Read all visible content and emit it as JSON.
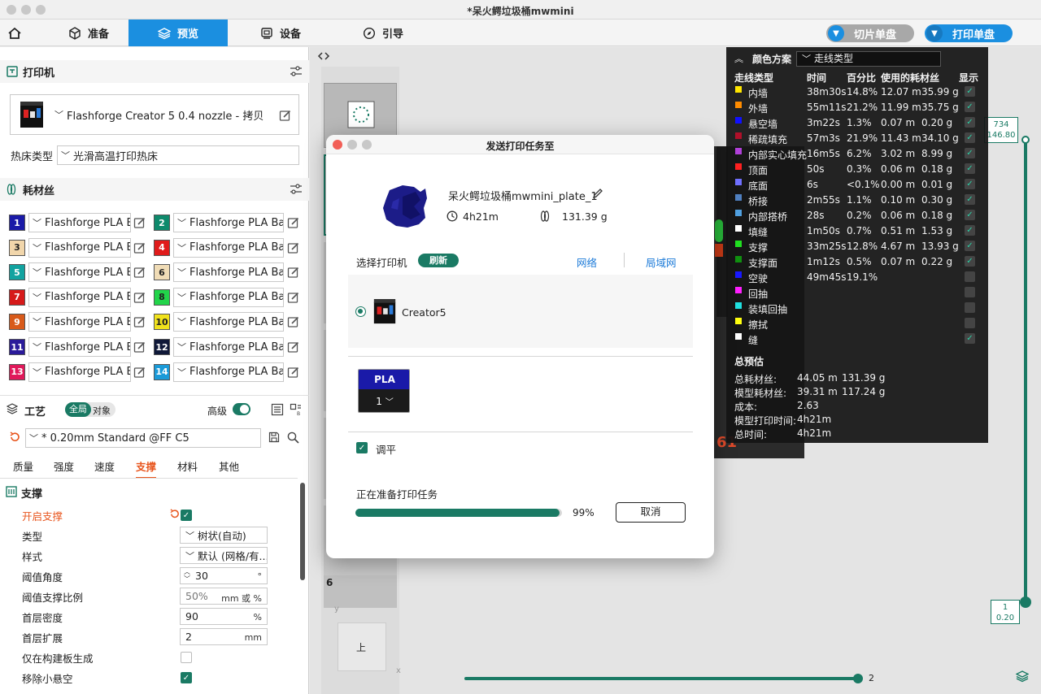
{
  "window": {
    "title": "*呆火鳄垃圾桶mwmini"
  },
  "toolbar": {
    "tabs": [
      {
        "label": "准备"
      },
      {
        "label": "预览"
      },
      {
        "label": "设备"
      },
      {
        "label": "引导"
      }
    ],
    "slice_button": "切片单盘",
    "print_button": "打印单盘"
  },
  "printer_section": {
    "title": "打印机",
    "printer_name": "Flashforge Creator 5 0.4 nozzle - 拷贝",
    "bed_label": "热床类型",
    "bed_value": "光滑高温打印热床"
  },
  "filament_section": {
    "title": "耗材丝",
    "items": [
      {
        "num": "1",
        "color": "#1a1aa8",
        "name": "Flashforge PLA B..."
      },
      {
        "num": "2",
        "color": "#0e8a6c",
        "name": "Flashforge PLA Ba..."
      },
      {
        "num": "3",
        "color": "#f1d6ab",
        "name": "Flashforge PLA B..."
      },
      {
        "num": "4",
        "color": "#e01b1b",
        "name": "Flashforge PLA Ba..."
      },
      {
        "num": "5",
        "color": "#12a3a0",
        "name": "Flashforge PLA B..."
      },
      {
        "num": "6",
        "color": "#f0dcb6",
        "name": "Flashforge PLA Ba..."
      },
      {
        "num": "7",
        "color": "#d61a1a",
        "name": "Flashforge PLA B..."
      },
      {
        "num": "8",
        "color": "#22d44a",
        "name": "Flashforge PLA Ba..."
      },
      {
        "num": "9",
        "color": "#d85a1a",
        "name": "Flashforge PLA B..."
      },
      {
        "num": "10",
        "color": "#f1e21c",
        "name": "Flashforge PLA Ba..."
      },
      {
        "num": "11",
        "color": "#2a1a9a",
        "name": "Flashforge PLA B..."
      },
      {
        "num": "12",
        "color": "#0f1838",
        "name": "Flashforge PLA Ba..."
      },
      {
        "num": "13",
        "color": "#e0185a",
        "name": "Flashforge PLA B..."
      },
      {
        "num": "14",
        "color": "#1a9ad8",
        "name": "Flashforge PLA Ba..."
      }
    ]
  },
  "process_section": {
    "title": "工艺",
    "toggle_global": "全局",
    "toggle_object": "对象",
    "advanced_label": "高级",
    "profile": "* 0.20mm Standard @FF C5",
    "tabs": [
      "质量",
      "强度",
      "速度",
      "支撑",
      "材料",
      "其他"
    ],
    "active_tab": "支撑",
    "group_title": "支撑",
    "rows": [
      {
        "label": "开启支撑"
      },
      {
        "label": "类型",
        "value": "树状(自动)"
      },
      {
        "label": "样式",
        "value": "默认 (网格/有..."
      },
      {
        "label": "阈值角度",
        "value": "30",
        "unit": "°"
      },
      {
        "label": "阈值支撑比例",
        "value": "50%",
        "unit": "mm 或 %"
      },
      {
        "label": "首层密度",
        "value": "90",
        "unit": "%"
      },
      {
        "label": "首层扩展",
        "value": "2",
        "unit": "mm"
      },
      {
        "label": "仅在构建板生成"
      },
      {
        "label": "移除小悬空"
      }
    ]
  },
  "legend": {
    "title": "颜色方案",
    "scheme": "走线类型",
    "headers": [
      "走线类型",
      "时间",
      "百分比",
      "使用的耗材丝",
      "显示"
    ],
    "rows": [
      {
        "name": "内墙",
        "color": "#ffe600",
        "time": "38m30s",
        "pct": "14.8%",
        "len": "12.07 m",
        "weight": "35.99 g",
        "shown": true
      },
      {
        "name": "外墙",
        "color": "#ff8c00",
        "time": "55m11s",
        "pct": "21.2%",
        "len": "11.99 m",
        "weight": "35.75 g",
        "shown": true
      },
      {
        "name": "悬空墙",
        "color": "#1010ff",
        "time": "3m22s",
        "pct": "1.3%",
        "len": "0.07 m",
        "weight": "0.20 g",
        "shown": true
      },
      {
        "name": "稀疏填充",
        "color": "#b0102a",
        "time": "57m3s",
        "pct": "21.9%",
        "len": "11.43 m",
        "weight": "34.10 g",
        "shown": true
      },
      {
        "name": "内部实心填充",
        "color": "#b040d8",
        "time": "16m5s",
        "pct": "6.2%",
        "len": "3.02 m",
        "weight": "8.99 g",
        "shown": true
      },
      {
        "name": "顶面",
        "color": "#ff2020",
        "time": "50s",
        "pct": "0.3%",
        "len": "0.06 m",
        "weight": "0.18 g",
        "shown": true
      },
      {
        "name": "底面",
        "color": "#7070ff",
        "time": "6s",
        "pct": "<0.1%",
        "len": "0.00 m",
        "weight": "0.01 g",
        "shown": true
      },
      {
        "name": "桥接",
        "color": "#5080c0",
        "time": "2m55s",
        "pct": "1.1%",
        "len": "0.10 m",
        "weight": "0.30 g",
        "shown": true
      },
      {
        "name": "内部搭桥",
        "color": "#50a0e0",
        "time": "28s",
        "pct": "0.2%",
        "len": "0.06 m",
        "weight": "0.18 g",
        "shown": true
      },
      {
        "name": "填缝",
        "color": "#ffffff",
        "time": "1m50s",
        "pct": "0.7%",
        "len": "0.51 m",
        "weight": "1.53 g",
        "shown": true
      },
      {
        "name": "支撑",
        "color": "#20e020",
        "time": "33m25s",
        "pct": "12.8%",
        "len": "4.67 m",
        "weight": "13.93 g",
        "shown": true
      },
      {
        "name": "支撑面",
        "color": "#109010",
        "time": "1m12s",
        "pct": "0.5%",
        "len": "0.07 m",
        "weight": "0.22 g",
        "shown": true
      },
      {
        "name": "空驶",
        "color": "#1818ff",
        "time": "49m45s",
        "pct": "19.1%",
        "len": "",
        "weight": "",
        "shown": false
      },
      {
        "name": "回抽",
        "color": "#ff20ff",
        "time": "",
        "pct": "",
        "len": "",
        "weight": "",
        "shown": false
      },
      {
        "name": "装填回抽",
        "color": "#20e0e0",
        "time": "",
        "pct": "",
        "len": "",
        "weight": "",
        "shown": false
      },
      {
        "name": "擦拭",
        "color": "#ffff10",
        "time": "",
        "pct": "",
        "len": "",
        "weight": "",
        "shown": false
      },
      {
        "name": "缝",
        "color": "#ffffff",
        "time": "",
        "pct": "",
        "len": "",
        "weight": "",
        "shown": true
      }
    ],
    "summary_title": "总预估",
    "summary": [
      {
        "label": "总耗材丝:",
        "v1": "44.05 m",
        "v2": "131.39 g"
      },
      {
        "label": "模型耗材丝:",
        "v1": "39.31 m",
        "v2": "117.24 g"
      },
      {
        "label": "成本:",
        "v1": "2.63",
        "v2": ""
      },
      {
        "label": "模型打印时间:",
        "v1": "4h21m",
        "v2": ""
      },
      {
        "label": "总时间:",
        "v1": "4h21m",
        "v2": ""
      }
    ]
  },
  "layer_slider": {
    "top_value": "734",
    "top_height": "146.80",
    "bottom_value": "1",
    "bottom_height": "0.20"
  },
  "move_slider": {
    "value": "2"
  },
  "viewport_misc": {
    "layer_marker": "61",
    "thumb_index": "6",
    "cube_face": "上",
    "axis_y": "y",
    "axis_x": "x"
  },
  "modal": {
    "title": "发送打印任务至",
    "job_name": "呆火鳄垃圾桶mwmini_plate_1",
    "time": "4h21m",
    "weight": "131.39 g",
    "select_printer_label": "选择打印机",
    "refresh_button": "刷新",
    "tab_network": "网络",
    "tab_lan": "局域网",
    "printer_name": "Creator5",
    "material_type": "PLA",
    "slot_value": "1",
    "leveling_label": "调平",
    "status_text": "正在准备打印任务",
    "progress": 0.99,
    "progress_text": "99%",
    "cancel_button": "取消"
  }
}
